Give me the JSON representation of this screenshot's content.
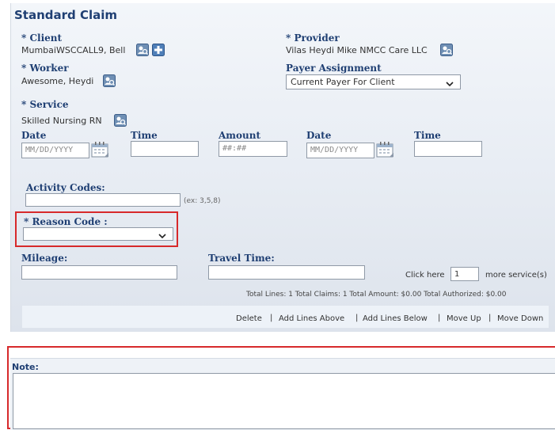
{
  "form": {
    "title": "Standard Claim",
    "client_label": "* Client",
    "client_value": "MumbaiWSCCALL9, Bell",
    "provider_label": "* Provider",
    "provider_value": "Vilas Heydi Mike NMCC Care LLC",
    "worker_label": "* Worker",
    "worker_value": "Awesome, Heydi",
    "payer_label": "Payer Assignment",
    "payer_value": "Current Payer For Client",
    "service_label": "* Service",
    "service_value": "Skilled Nursing RN"
  },
  "line": {
    "date1_label": "Date",
    "date1_placeholder": "MM/DD/YYYY",
    "time1_label": "Time",
    "amount_label": "Amount",
    "amount_placeholder": "##:##",
    "date2_label": "Date",
    "date2_placeholder": "MM/DD/YYYY",
    "time2_label": "Time",
    "activity_label": "Activity Codes:",
    "activity_hint": "(ex: 3,5,8)",
    "reason_label": "* Reason Code :",
    "reason_value": "",
    "mileage_label": "Mileage:",
    "travel_label": "Travel Time:",
    "click_here": "Click here",
    "more_count": "1",
    "more_services": "more service(s)",
    "totals": "Total Lines: 1 Total Claims: 1 Total Amount: $0.00 Total Authorized: $0.00"
  },
  "actions": {
    "delete": "Delete",
    "add_above": "Add Lines Above",
    "add_below": "Add Lines Below",
    "move_up": "Move Up",
    "move_down": "Move Down",
    "separator": "|"
  },
  "note": {
    "label": "Note:"
  },
  "icons": {
    "lookup": "search-person-icon",
    "add": "add-plus-icon",
    "calendar": "calendar-icon",
    "dropdown": "chevron-down-icon"
  },
  "colors": {
    "label_blue": "#1f3f73",
    "highlight_red": "#d7292b"
  }
}
